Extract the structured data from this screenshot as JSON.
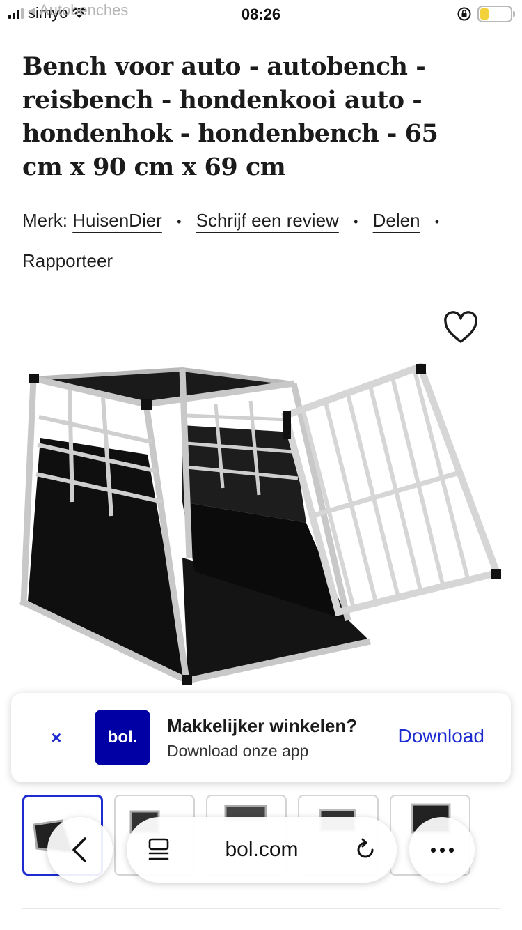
{
  "status_bar": {
    "carrier": "simyo",
    "back_app": "Autobenches",
    "time": "08:26"
  },
  "product": {
    "title": "Bench voor auto - autobench - reisbench - hondenkooi auto - hondenhok - hondenbench - 65 cm x 90 cm x 69 cm",
    "brand_prefix": "Merk:",
    "brand": "HuisenDier",
    "review_link": "Schrijf een review",
    "share_link": "Delen",
    "report_link": "Rapporteer",
    "separator": "•"
  },
  "app_banner": {
    "close": "×",
    "logo": "bol.",
    "title": "Makkelijker winkelen?",
    "subtitle": "Download onze app",
    "download": "Download"
  },
  "browser": {
    "url": "bol.com"
  },
  "colors": {
    "brand_blue": "#0000a4",
    "link_blue": "#1d2bd0",
    "battery_yellow": "#f3d13a"
  },
  "icons": [
    "signal-icon",
    "wifi-icon",
    "orientation-lock-icon",
    "battery-icon",
    "heart-icon",
    "close-icon",
    "back-chevron-icon",
    "reader-icon",
    "reload-icon",
    "more-icon"
  ]
}
